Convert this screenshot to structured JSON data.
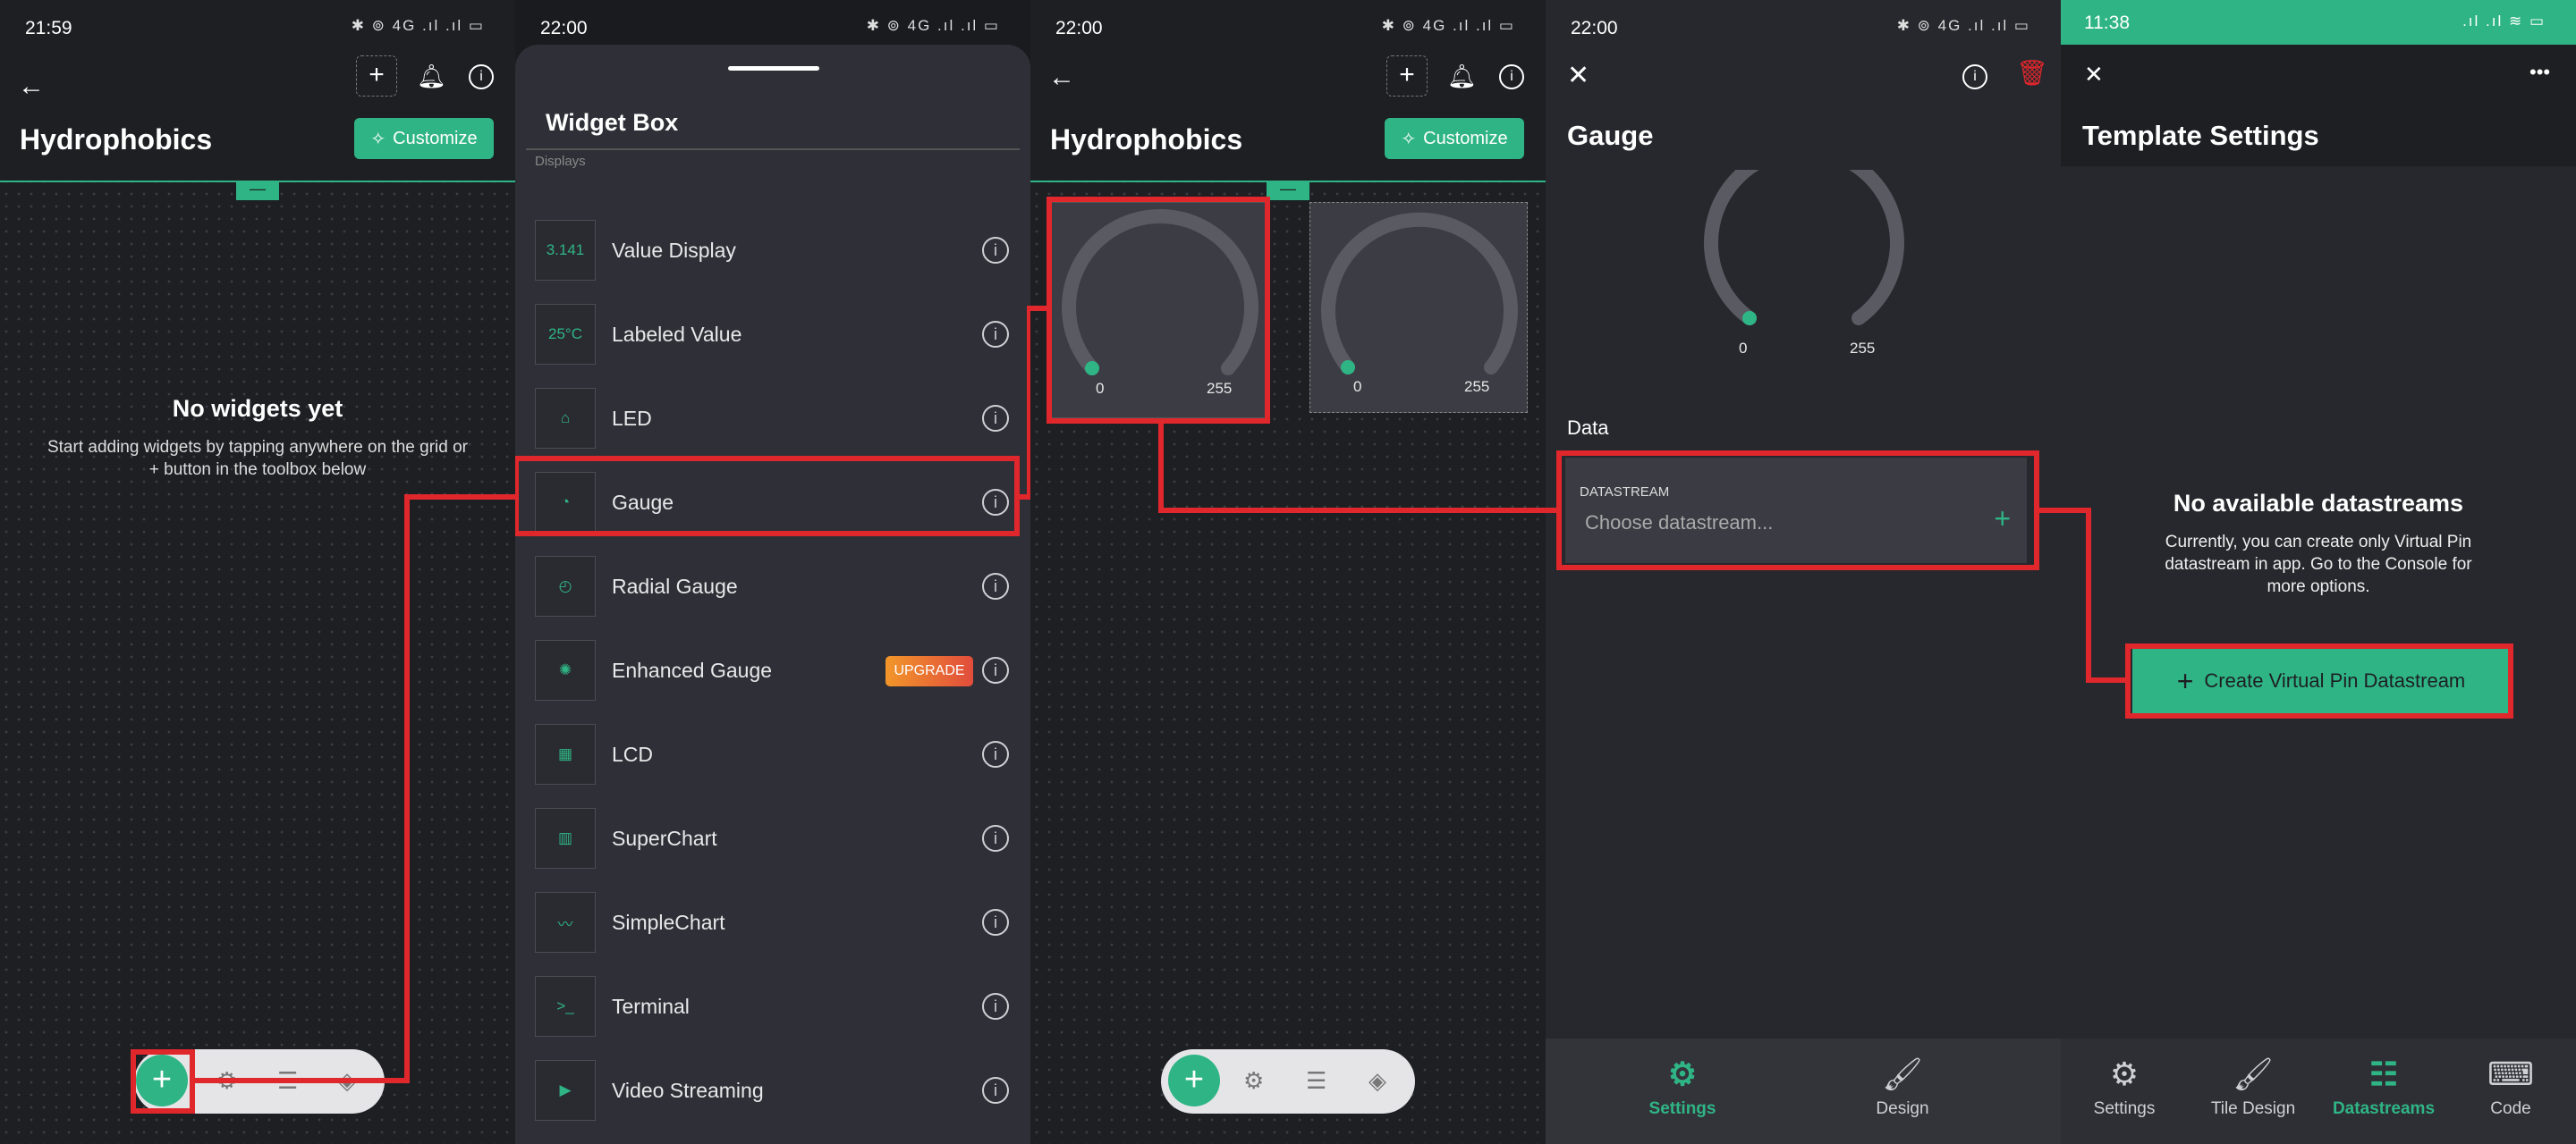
{
  "colors": {
    "accent": "#2fb585",
    "highlight": "#e0272c",
    "upgrade": "#f2962a"
  },
  "screen1": {
    "time": "21:59",
    "status_icons": "✱ ⊚ 4G .ıl .ıl ▭",
    "title": "Hydrophobics",
    "customize": "Customize",
    "collapse": "—",
    "empty_title": "No widgets yet",
    "empty_text": "Start adding widgets by tapping anywhere on the grid or + button in the toolbox below",
    "toolbar_icons": [
      "plus-icon",
      "gear-icon",
      "sliders-icon",
      "layers-icon"
    ]
  },
  "screen2": {
    "time": "22:00",
    "status_icons": "✱ ⊚ 4G .ıl .ıl ▭",
    "title": "Widget Box",
    "section": "Displays",
    "widgets": [
      {
        "label": "Value Display",
        "icon": "3.141",
        "upgrade": ""
      },
      {
        "label": "Labeled Value",
        "icon": "25°C",
        "upgrade": ""
      },
      {
        "label": "LED",
        "icon": "led",
        "upgrade": ""
      },
      {
        "label": "Gauge",
        "icon": "gauge",
        "upgrade": ""
      },
      {
        "label": "Radial Gauge",
        "icon": "radial",
        "upgrade": ""
      },
      {
        "label": "Enhanced Gauge",
        "icon": "enhanced",
        "upgrade": "UPGRADE"
      },
      {
        "label": "LCD",
        "icon": "lcd",
        "upgrade": ""
      },
      {
        "label": "SuperChart",
        "icon": "superchart",
        "upgrade": ""
      },
      {
        "label": "SimpleChart",
        "icon": "simplechart",
        "upgrade": ""
      },
      {
        "label": "Terminal",
        "icon": "terminal",
        "upgrade": ""
      },
      {
        "label": "Video Streaming",
        "icon": "video",
        "upgrade": ""
      }
    ]
  },
  "screen3": {
    "time": "22:00",
    "status_icons": "✱ ⊚ 4G .ıl .ıl ▭",
    "title": "Hydrophobics",
    "customize": "Customize",
    "gauges": [
      {
        "min": "0",
        "max": "255"
      },
      {
        "min": "0",
        "max": "255"
      }
    ]
  },
  "screen4": {
    "time": "22:00",
    "status_icons": "✱ ⊚ 4G .ıl .ıl ▭",
    "title": "Gauge",
    "gauge": {
      "min": "0",
      "max": "255"
    },
    "data_heading": "Data",
    "datastream_label": "DATASTREAM",
    "datastream_placeholder": "Choose datastream...",
    "nav": [
      {
        "label": "Settings",
        "icon": "gear-icon",
        "active": true
      },
      {
        "label": "Design",
        "icon": "brush-icon",
        "active": false
      }
    ]
  },
  "screen5": {
    "time": "11:38",
    "status_icons": ".ıl .ıl ≋ ▭",
    "title": "Template Settings",
    "empty_title": "No available datastreams",
    "empty_text": "Currently, you can create only Virtual Pin datastream in app. Go to the Console for more options.",
    "create_button": "Create Virtual Pin Datastream",
    "nav": [
      {
        "label": "Settings"
      },
      {
        "label": "Tile Design"
      },
      {
        "label": "Datastreams"
      },
      {
        "label": "Code"
      }
    ]
  }
}
